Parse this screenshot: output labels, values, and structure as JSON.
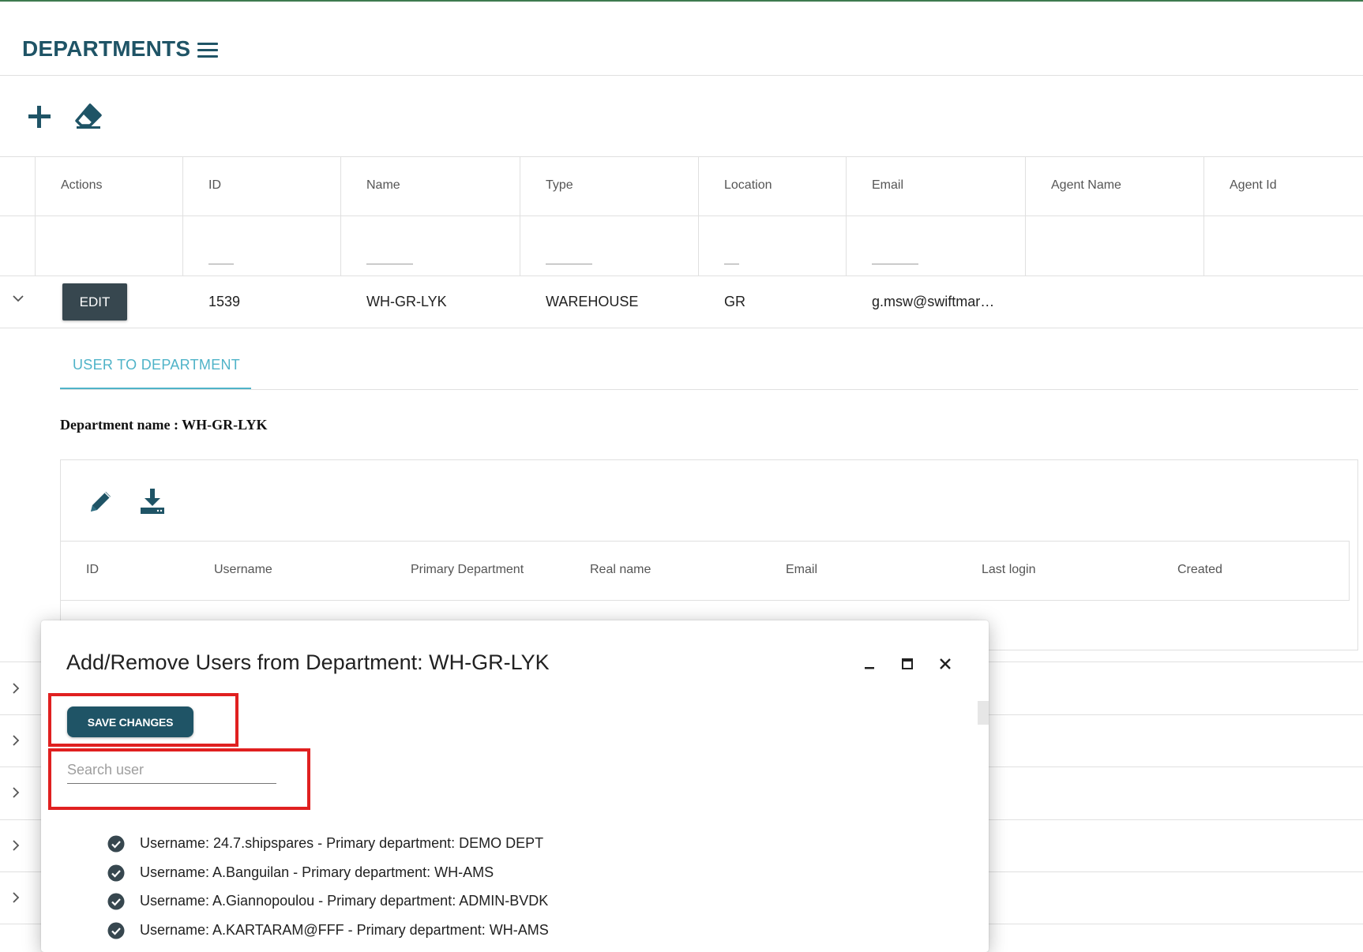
{
  "header": {
    "title": "DEPARTMENTS"
  },
  "grid": {
    "columns": [
      "Actions",
      "ID",
      "Name",
      "Type",
      "Location",
      "Email",
      "Agent Name",
      "Agent Id"
    ],
    "row": {
      "edit_label": "EDIT",
      "id": "1539",
      "name": "WH-GR-LYK",
      "type": "WAREHOUSE",
      "location": "GR",
      "email": "g.msw@swiftmar…"
    }
  },
  "detail": {
    "tab_label": "USER TO DEPARTMENT",
    "department_name": "Department name : WH-GR-LYK",
    "columns": [
      "ID",
      "Username",
      "Primary Department",
      "Real name",
      "Email",
      "Last login",
      "Created"
    ]
  },
  "dialog": {
    "title": "Add/Remove Users from Department: WH-GR-LYK",
    "save_label": "SAVE CHANGES",
    "search_placeholder": "Search user",
    "users": [
      "Username: 24.7.shipspares - Primary department: DEMO DEPT",
      "Username: A.Banguilan - Primary department: WH-AMS",
      "Username: A.Giannopoulou - Primary department: ADMIN-BVDK",
      "Username: A.KARTARAM@FFF - Primary department: WH-AMS"
    ]
  },
  "colors": {
    "primary": "#1f5466",
    "accent": "#4fb3c8",
    "highlight": "#e02020",
    "edit_button": "#37474f"
  },
  "icons": [
    "menu-icon",
    "add-icon",
    "eraser-icon",
    "chevron-down-icon",
    "chevron-right-icon",
    "pencil-icon",
    "download-icon",
    "minimize-icon",
    "maximize-icon",
    "close-icon",
    "check-circle-icon"
  ]
}
